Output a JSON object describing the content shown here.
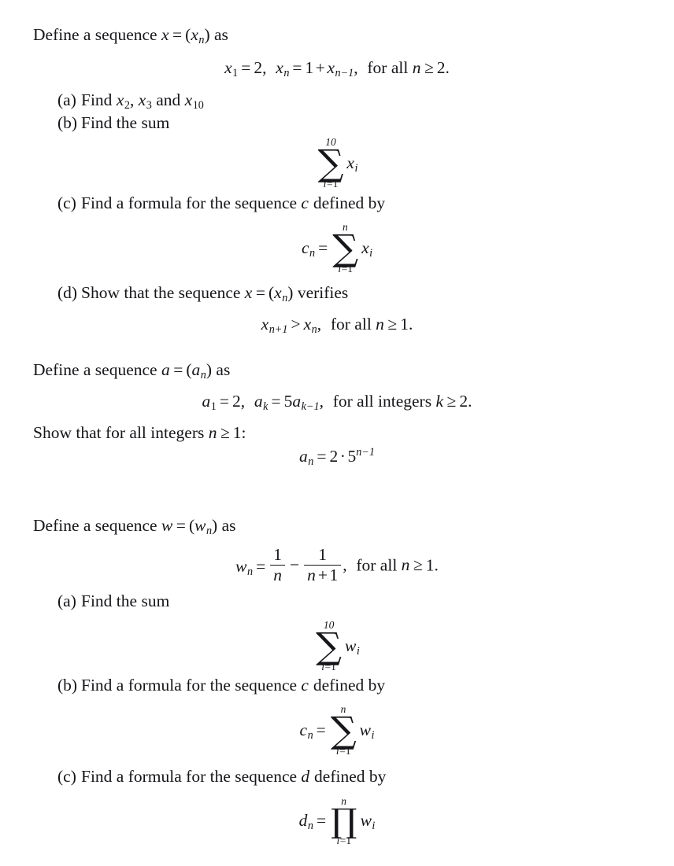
{
  "document": {
    "type": "math-exercise-sheet",
    "text_color": "#16161a",
    "background": "#ffffff"
  },
  "blocks": {
    "b1_intro": {
      "lead": "Define a sequence ",
      "var": "x",
      "eq": "=",
      "seq_open": "(",
      "seq_var": "x",
      "seq_sub": "n",
      "seq_close": ")",
      "tail": " as"
    },
    "b1_recurrence": {
      "x1": "x",
      "x1_sub": "1",
      "eq1": "=",
      "val1": "2",
      "comma1": ",",
      "xn": "x",
      "xn_sub": "n",
      "eq2": "=",
      "one": "1",
      "plus": "+",
      "xprev": "x",
      "xprev_sub": "n−1",
      "comma2": ",",
      "cond": "for all ",
      "cond_var": "n",
      "geq": "≥",
      "cond_val": "2."
    },
    "b1_items": [
      {
        "tag": "(a)",
        "text_before": "Find ",
        "v1": "x",
        "v1_sub": "2",
        "sep1": ", ",
        "v2": "x",
        "v2_sub": "3",
        "sep2": " and ",
        "v3": "x",
        "v3_sub": "10"
      },
      {
        "tag": "(b)",
        "text": "Find the sum"
      },
      {
        "tag": "(c)",
        "text_a": "Find a formula for the sequence ",
        "seq": "c",
        "text_b": " defined by"
      },
      {
        "tag": "(d)",
        "text_a": "Show that the sequence ",
        "var": "x",
        "eq": "=",
        "open": "(",
        "sub_var": "x",
        "sub_idx": "n",
        "close": ")",
        "text_b": " verifies"
      }
    ],
    "b1_sum10": {
      "upper": "10",
      "glyph": "∑",
      "lower_i": "i",
      "lower_eq": "=",
      "lower_val": "1",
      "body_var": "x",
      "body_sub": "i"
    },
    "b1_cn": {
      "lhs_var": "c",
      "lhs_sub": "n",
      "eq": "=",
      "upper": "n",
      "glyph": "∑",
      "lower_i": "i",
      "lower_eq": "=",
      "lower_val": "1",
      "body_var": "x",
      "body_sub": "i"
    },
    "b1_increasing": {
      "lhs": "x",
      "lhs_sub": "n+1",
      "gt": ">",
      "rhs": "x",
      "rhs_sub": "n",
      "comma": ",",
      "cond": "for all  ",
      "cond_var": "n",
      "geq": "≥",
      "cond_val": "1."
    },
    "b2_intro": {
      "lead": "Define a sequence ",
      "var": "a",
      "eq": "=",
      "seq_open": "(",
      "seq_var": "a",
      "seq_sub": "n",
      "seq_close": ")",
      "tail": " as"
    },
    "b2_recurrence": {
      "a1": "a",
      "a1_sub": "1",
      "eq1": "=",
      "val1": "2",
      "comma1": ",",
      "ak": "a",
      "ak_sub": "k",
      "eq2": "=",
      "coef": "5",
      "aprev": "a",
      "aprev_sub": "k−1",
      "comma2": ",",
      "cond": "for all integers ",
      "cond_var": "k",
      "geq": "≥",
      "cond_val": "2."
    },
    "b2_show": {
      "text": "Show that for all integers ",
      "var": "n",
      "geq": "≥",
      "val": "1:"
    },
    "b2_closed_form": {
      "lhs": "a",
      "lhs_sub": "n",
      "eq": "=",
      "coef": "2",
      "dot": "·",
      "base": "5",
      "exp": "n−1"
    },
    "b3_intro": {
      "lead": "Define a sequence ",
      "var": "w",
      "eq": "=",
      "seq_open": "(",
      "seq_var": "w",
      "seq_sub": "n",
      "seq_close": ")",
      "tail": " as"
    },
    "b3_definition": {
      "lhs": "w",
      "lhs_sub": "n",
      "eq": "=",
      "f1_num": "1",
      "f1_den": "n",
      "minus": "−",
      "f2_num": "1",
      "f2_den_n": "n",
      "f2_den_plus": "+",
      "f2_den_one": "1",
      "comma": ",",
      "cond": "for all ",
      "cond_var": "n",
      "geq": "≥",
      "cond_val": "1."
    },
    "b3_items": [
      {
        "tag": "(a)",
        "text": "Find the sum"
      },
      {
        "tag": "(b)",
        "text_a": "Find a formula for the sequence ",
        "seq": "c",
        "text_b": " defined by"
      },
      {
        "tag": "(c)",
        "text_a": "Find a formula for the sequence ",
        "seq": "d",
        "text_b": " defined by"
      }
    ],
    "b3_sum10": {
      "upper": "10",
      "glyph": "∑",
      "lower_i": "i",
      "lower_eq": "=",
      "lower_val": "1",
      "body_var": "w",
      "body_sub": "i"
    },
    "b3_cn": {
      "lhs_var": "c",
      "lhs_sub": "n",
      "eq": "=",
      "upper": "n",
      "glyph": "∑",
      "lower_i": "i",
      "lower_eq": "=",
      "lower_val": "1",
      "body_var": "w",
      "body_sub": "i"
    },
    "b3_dn": {
      "lhs_var": "d",
      "lhs_sub": "n",
      "eq": "=",
      "upper": "n",
      "glyph": "∏",
      "lower_i": "i",
      "lower_eq": "=",
      "lower_val": "1",
      "body_var": "w",
      "body_sub": "i"
    }
  }
}
